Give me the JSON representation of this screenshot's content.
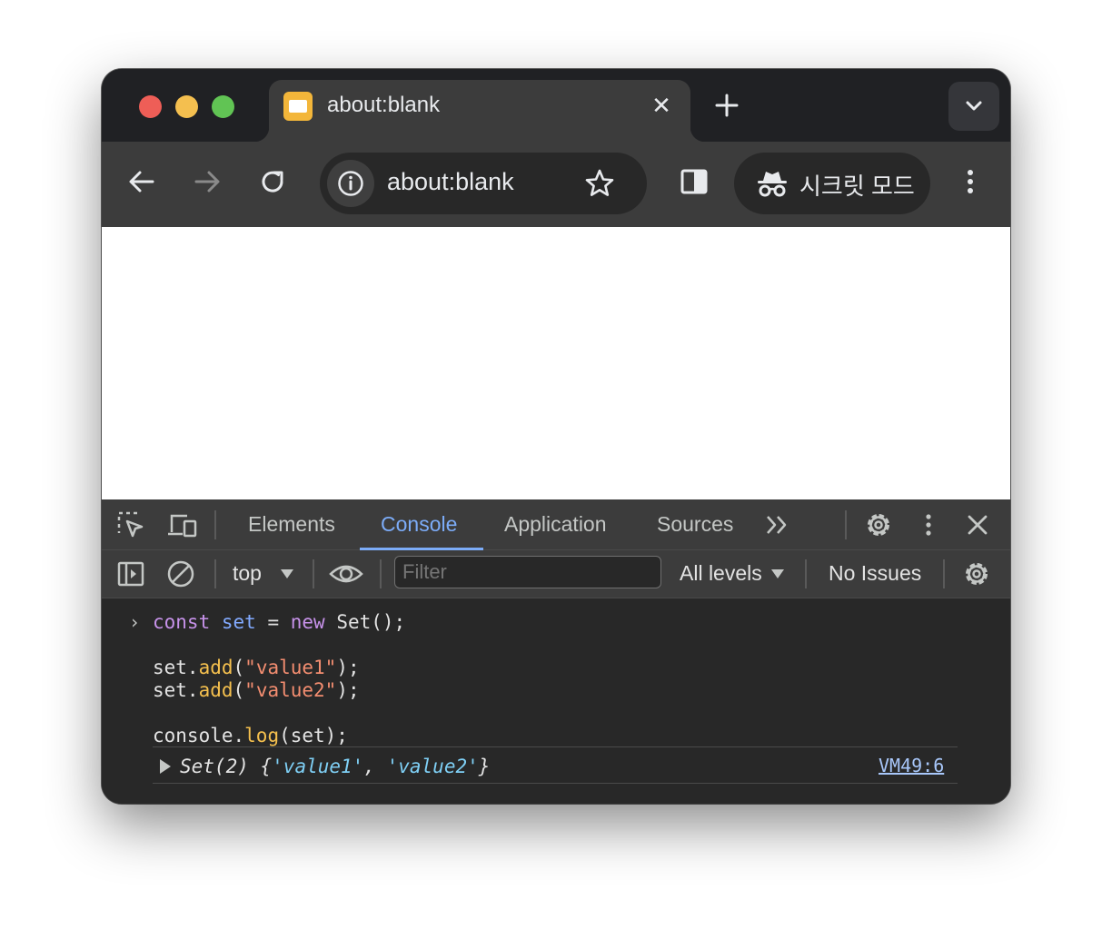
{
  "browser": {
    "tab_title": "about:blank",
    "address": "about:blank",
    "incognito_label": "시크릿 모드"
  },
  "devtools": {
    "tabs": [
      "Elements",
      "Console",
      "Application",
      "Sources"
    ],
    "active_tab": "Console",
    "context_label": "top",
    "filter_placeholder": "Filter",
    "levels_label": "All levels",
    "issues_label": "No Issues"
  },
  "console": {
    "input_lines": [
      "const set = new Set();",
      "",
      "set.add(\"value1\");",
      "set.add(\"value2\");",
      "",
      "console.log(set);"
    ],
    "output": "Set(2) {'value1', 'value2'}",
    "source_link": "VM49:6"
  },
  "colors": {
    "accent": "#7cacf8",
    "keyword": "#c792ea",
    "variable": "#82aaff",
    "function": "#f5c04e",
    "string": "#f38d70"
  }
}
